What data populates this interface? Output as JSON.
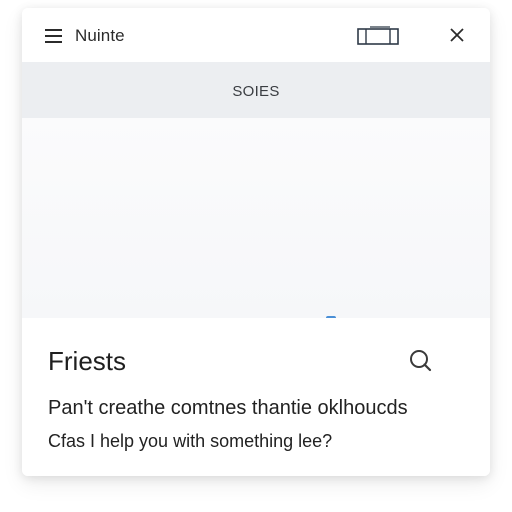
{
  "app": {
    "title": "Nuinte"
  },
  "subheader": {
    "label": "SOIES"
  },
  "panel": {
    "title": "Friests",
    "line1": "Pan't creathe comtnes thantie oklhoucds",
    "line2": "Cfas I help you with something lee?"
  },
  "icons": {
    "menu": "hamburger-menu-icon",
    "window": "window-restore-icon",
    "close": "close-icon",
    "search": "search-icon"
  },
  "colors": {
    "subheader_bg": "#eceef1",
    "accent": "#4a8fd6"
  }
}
